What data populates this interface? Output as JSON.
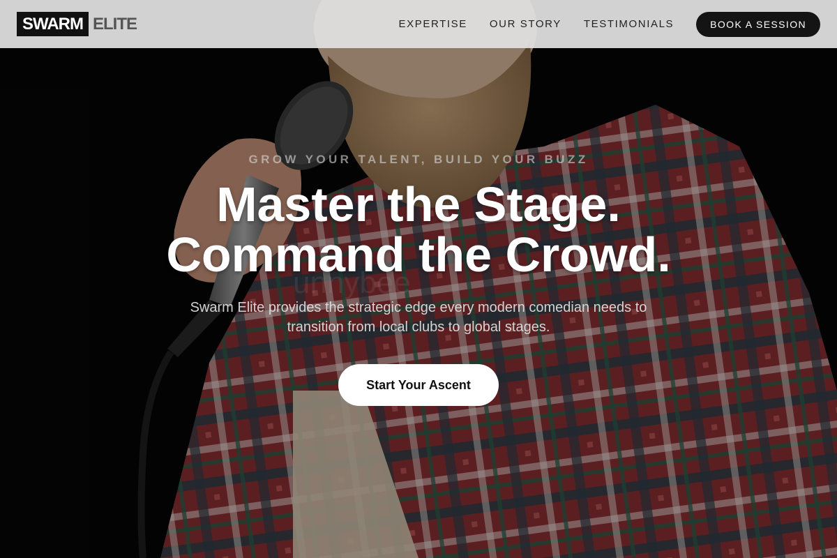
{
  "brand": {
    "name_part1": "SWARM",
    "name_part2": "ELITE"
  },
  "nav": {
    "links": [
      "EXPERTISE",
      "OUR STORY",
      "TESTIMONIALS"
    ],
    "cta_label": "BOOK A SESSION"
  },
  "hero": {
    "eyebrow": "GROW YOUR TALENT, BUILD YOUR BUZZ",
    "headline_line1": "Master the Stage.",
    "headline_line2": "Command the Crowd.",
    "subhead": "Swarm Elite provides the strategic edge every modern comedian needs to transition from local clubs to global stages.",
    "cta_label": "Start Your Ascent"
  },
  "colors": {
    "nav_background": "#e2e2e2",
    "nav_cta": "#141414",
    "hero_overlay": "#000000",
    "text_primary": "#ffffff"
  },
  "icons": {
    "background": "comedian-with-microphone-photo"
  }
}
